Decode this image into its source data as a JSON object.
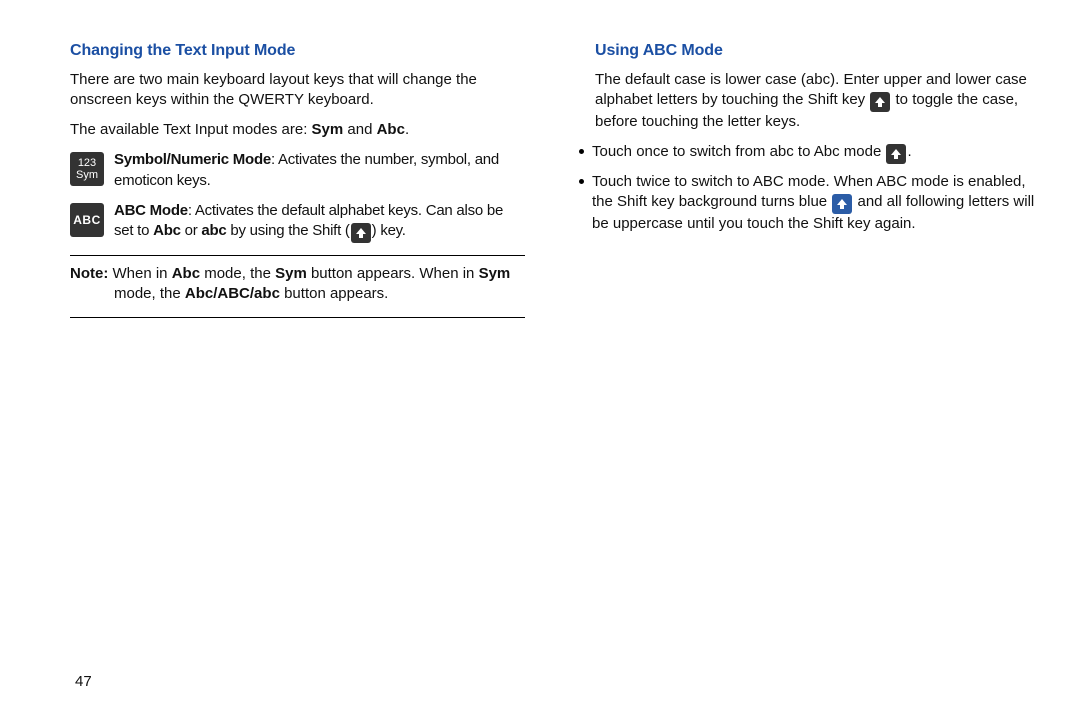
{
  "pageNumber": "47",
  "left": {
    "heading": "Changing the Text Input Mode",
    "p1": "There are two main keyboard layout keys that will change the onscreen keys within the QWERTY keyboard.",
    "p2_before": "The available Text Input modes are: ",
    "p2_bold1": "Sym",
    "p2_mid": " and ",
    "p2_bold2": "Abc",
    "p2_after": ".",
    "sym_icon_l1": "123",
    "sym_icon_l2": "Sym",
    "sym_bold": "Symbol/Numeric Mode",
    "sym_rest": ": Activates the number, symbol, and emoticon keys.",
    "abc_icon": "ABC",
    "abc_bold": "ABC Mode",
    "abc_rest1": ": Activates the default alphabet keys. Can also be set to ",
    "abc_b1": "Abc",
    "abc_or": " or ",
    "abc_b2": "abc",
    "abc_rest2": " by using the Shift (",
    "abc_rest3": ") key.",
    "note_label": "Note:",
    "note_t1": " When in ",
    "note_b1": "Abc",
    "note_t2": " mode, the ",
    "note_b2": "Sym",
    "note_t3": " button appears. When in ",
    "note_b3": "Sym",
    "note_t4": " mode, the ",
    "note_b4": "Abc/ABC/abc",
    "note_t5": " button appears."
  },
  "right": {
    "heading": "Using ABC Mode",
    "p1_a": "The default case is lower case (abc). Enter upper and lower case alphabet letters by touching the Shift key ",
    "p1_b": " to toggle the case, before touching the letter keys.",
    "b1_a": "Touch once to switch from abc to Abc mode ",
    "b1_b": ".",
    "b2_a": "Touch twice to switch to ABC mode. When ABC mode is enabled, the Shift key background turns blue ",
    "b2_b": " and all following letters will be uppercase until you touch the Shift key again."
  }
}
